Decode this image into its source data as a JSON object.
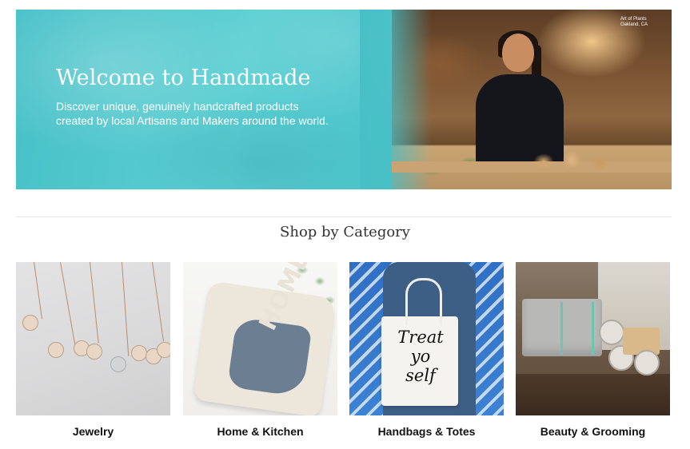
{
  "hero": {
    "title": "Welcome to Handmade",
    "subtitle_lines": [
      "Discover unique, genuinely handcrafted products",
      "created by local Artisans and Makers around the world."
    ],
    "photo_credit_lines": [
      "Art of Plants",
      "Oakland, CA"
    ],
    "colors": {
      "teal": "#4fc6cc",
      "text": "#ffffff"
    }
  },
  "categories_section": {
    "title": "Shop by Category",
    "items": [
      {
        "label": "Jewelry"
      },
      {
        "label": "Home & Kitchen",
        "image_text": "HOME"
      },
      {
        "label": "Handbags & Totes",
        "image_text_lines": [
          "Treat",
          "yo",
          "self"
        ]
      },
      {
        "label": "Beauty & Grooming"
      }
    ]
  }
}
